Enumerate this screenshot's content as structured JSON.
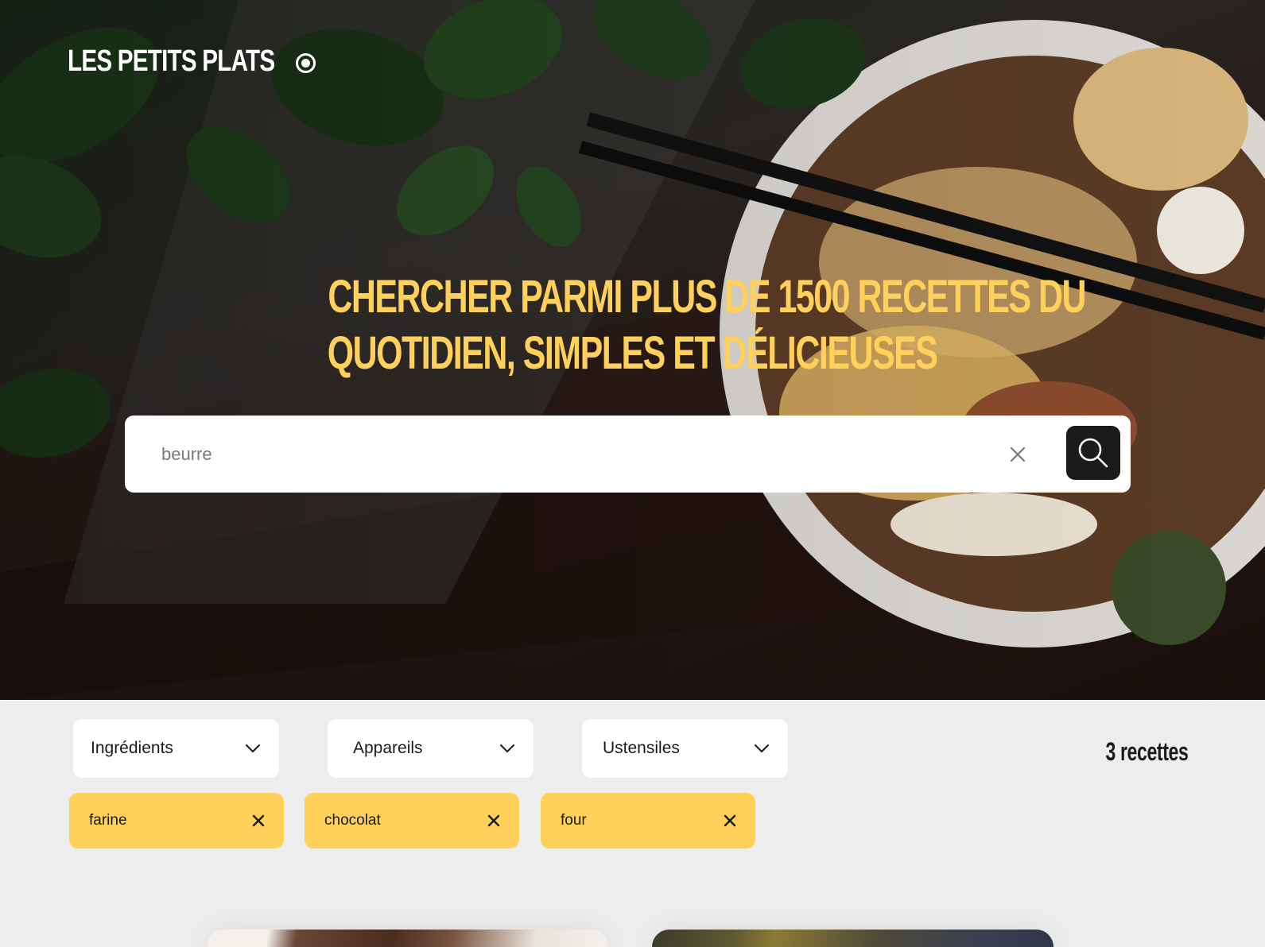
{
  "header": {
    "logo_text": "LES PETITS PLATS",
    "headline_line1": "CHERCHER PARMI PLUS DE 1500 RECETTES DU",
    "headline_line2": "QUOTIDIEN, SIMPLES ET DÉLICIEUSES"
  },
  "search": {
    "value": "beurre",
    "clear_icon": "close-icon",
    "submit_icon": "search-icon"
  },
  "filters": {
    "dropdowns": [
      {
        "label": "Ingrédients",
        "icon": "chevron-down-icon"
      },
      {
        "label": "Appareils",
        "icon": "chevron-down-icon"
      },
      {
        "label": "Ustensiles",
        "icon": "chevron-down-icon"
      }
    ],
    "recipe_count": "3 recettes",
    "tags": [
      {
        "label": "farine",
        "icon": "close-icon"
      },
      {
        "label": "chocolat",
        "icon": "close-icon"
      },
      {
        "label": "four",
        "icon": "close-icon"
      }
    ]
  },
  "colors": {
    "accent": "#FFD15B",
    "dark": "#1B1B1B",
    "background": "#EDEDED",
    "white": "#FFFFFF"
  }
}
